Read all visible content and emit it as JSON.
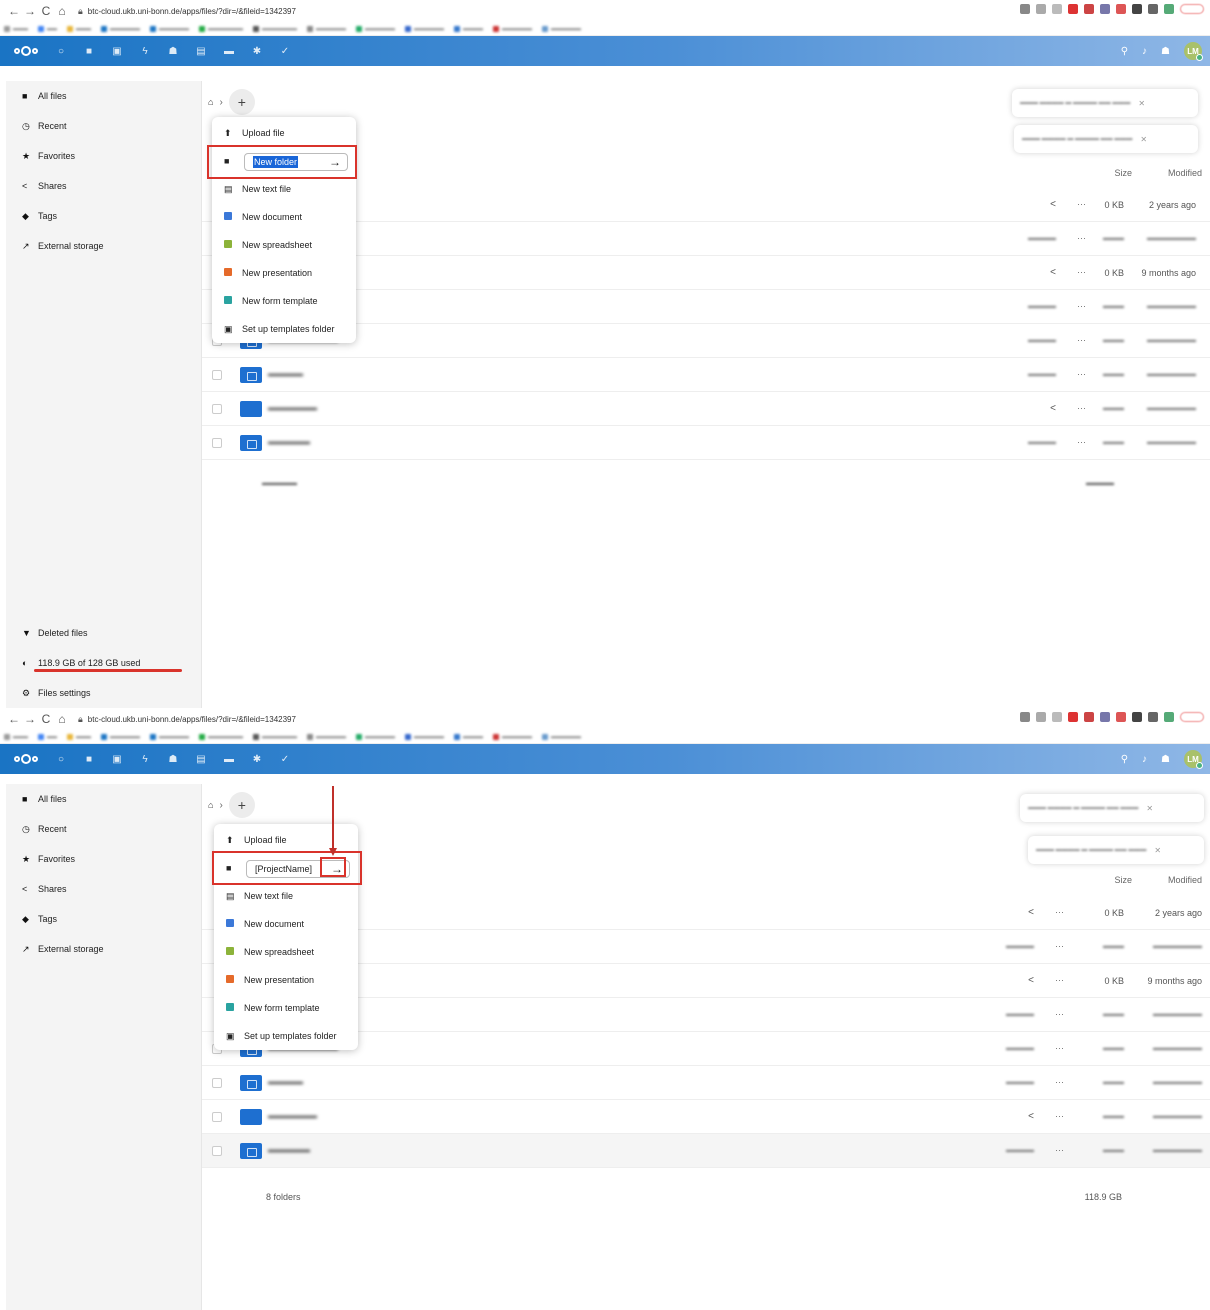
{
  "browser": {
    "url": "btc-cloud.ukb.uni-bonn.de/apps/files/?dir=/&fileid=1342397",
    "nav": {
      "back": "←",
      "forward": "→",
      "reload": "C",
      "home": "⌂"
    }
  },
  "header": {
    "avatar_initials": "LM"
  },
  "sidebar": {
    "items": [
      {
        "label": "All files",
        "icon": "folder-icon"
      },
      {
        "label": "Recent",
        "icon": "clock-icon"
      },
      {
        "label": "Favorites",
        "icon": "star-icon"
      },
      {
        "label": "Shares",
        "icon": "share-icon"
      },
      {
        "label": "Tags",
        "icon": "tag-icon"
      },
      {
        "label": "External storage",
        "icon": "external-link-icon"
      }
    ],
    "deleted_files": "Deleted files",
    "quota": "118.9 GB of 128 GB used",
    "settings": "Files settings"
  },
  "columns": {
    "size": "Size",
    "modified": "Modified"
  },
  "new_menu": {
    "upload": "Upload file",
    "new_folder_value_step1": "New folder",
    "new_folder_value_step2": "[ProjectName]",
    "new_text_file": "New text file",
    "new_document": "New document",
    "new_spreadsheet": "New spreadsheet",
    "new_presentation": "New presentation",
    "new_form_template": "New form template",
    "set_up_templates": "Set up templates folder"
  },
  "rows_visible": [
    {
      "size": "0 KB",
      "modified": "2 years ago"
    },
    {
      "size": "0 KB",
      "modified": "9 months ago"
    }
  ],
  "summary": {
    "folders": "8 folders",
    "total_size": "118.9 GB"
  }
}
